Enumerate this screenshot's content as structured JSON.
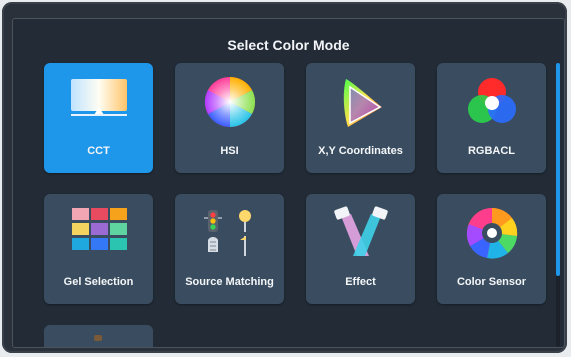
{
  "screen": {
    "title": "Select Color Mode"
  },
  "modes": [
    {
      "label": "CCT",
      "icon": "cct-gradient-icon",
      "selected": true
    },
    {
      "label": "HSI",
      "icon": "color-wheel-icon",
      "selected": false
    },
    {
      "label": "X,Y Coordinates",
      "icon": "cie-triangle-icon",
      "selected": false
    },
    {
      "label": "RGBACL",
      "icon": "rgb-circles-icon",
      "selected": false
    },
    {
      "label": "Gel Selection",
      "icon": "gel-swatches-icon",
      "selected": false
    },
    {
      "label": "Source Matching",
      "icon": "traffic-light-streetlamp-icon",
      "selected": false
    },
    {
      "label": "Effect",
      "icon": "spotlights-icon",
      "selected": false
    },
    {
      "label": "Color Sensor",
      "icon": "color-sensor-wheel-icon",
      "selected": false
    }
  ],
  "colors": {
    "accent": "#1e96ea",
    "tile": "#3a4d60",
    "background": "#222b36"
  },
  "scrollbar": {
    "position": "top"
  }
}
